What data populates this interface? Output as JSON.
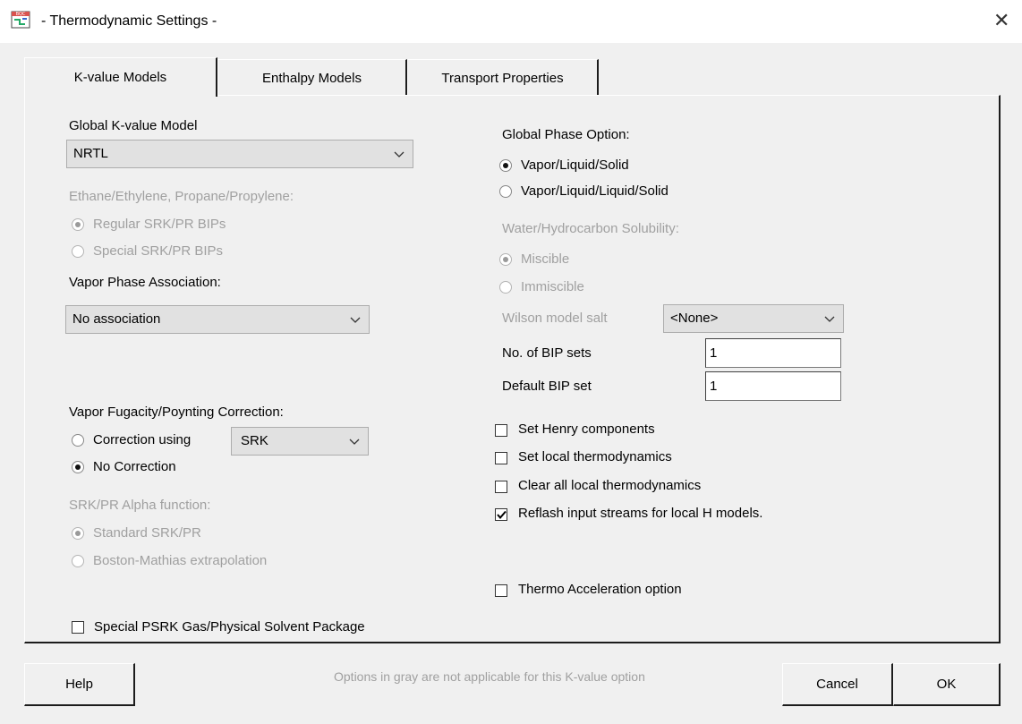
{
  "window": {
    "title": "- Thermodynamic Settings -",
    "app_icon": "thermo-app-icon",
    "close_icon": "close-icon"
  },
  "tabs": [
    {
      "label": "K-value Models",
      "active": true
    },
    {
      "label": "Enthalpy Models",
      "active": false
    },
    {
      "label": "Transport Properties",
      "active": false
    }
  ],
  "left": {
    "global_kvalue_label": "Global K-value Model",
    "global_kvalue_value": "NRTL",
    "ethane_label": "Ethane/Ethylene, Propane/Propylene:",
    "ethane_options": [
      "Regular SRK/PR BIPs",
      "Special SRK/PR BIPs"
    ],
    "ethane_selected": 0,
    "vapor_assoc_label": "Vapor Phase Association:",
    "vapor_assoc_value": "No association",
    "fugacity_label": "Vapor Fugacity/Poynting Correction:",
    "fugacity_options": [
      "Correction using",
      "No Correction"
    ],
    "fugacity_selected": 1,
    "fugacity_model_value": "SRK",
    "alpha_label": "SRK/PR Alpha function:",
    "alpha_options": [
      "Standard SRK/PR",
      "Boston-Mathias extrapolation"
    ],
    "alpha_selected": 0,
    "psrk_label": "Special PSRK Gas/Physical Solvent Package",
    "psrk_checked": false
  },
  "right": {
    "phase_label": "Global Phase Option:",
    "phase_options": [
      "Vapor/Liquid/Solid",
      "Vapor/Liquid/Liquid/Solid"
    ],
    "phase_selected": 0,
    "water_label": "Water/Hydrocarbon Solubility:",
    "water_options": [
      "Miscible",
      "Immiscible"
    ],
    "water_selected": 0,
    "wilson_label": "Wilson model salt",
    "wilson_value": "<None>",
    "bip_sets_label": "No. of BIP sets",
    "bip_sets_value": "1",
    "default_bip_label": "Default BIP set",
    "default_bip_value": "1",
    "checks": [
      {
        "label": "Set Henry components",
        "checked": false
      },
      {
        "label": "Set local thermodynamics",
        "checked": false
      },
      {
        "label": "Clear all local thermodynamics",
        "checked": false
      },
      {
        "label": "Reflash input streams for local H models.",
        "checked": true
      }
    ],
    "thermo_accel_label": "Thermo Acceleration option",
    "thermo_accel_checked": false
  },
  "footer": {
    "help_label": "Help",
    "note": "Options in gray are not applicable for this K-value option",
    "cancel_label": "Cancel",
    "ok_label": "OK"
  }
}
